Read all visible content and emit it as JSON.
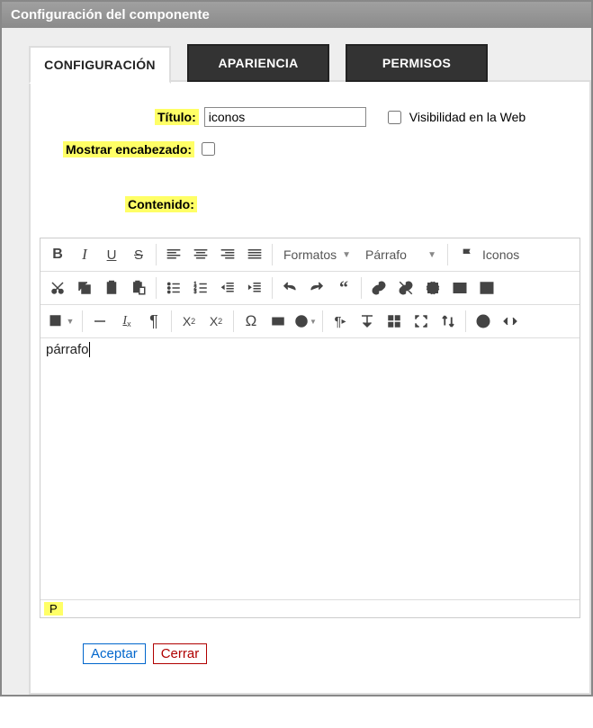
{
  "dialog": {
    "title": "Configuración del componente"
  },
  "tabs": {
    "config": "CONFIGURACIÓN",
    "appearance": "APARIENCIA",
    "perms": "PERMISOS"
  },
  "form": {
    "titulo_label": "Título:",
    "titulo_value": "iconos",
    "vis_web_label": "Visibilidad en la Web",
    "vis_web_checked": false,
    "show_header_label": "Mostrar encabezado:",
    "show_header_checked": false,
    "contenido_label": "Contenido:"
  },
  "editor": {
    "formats_label": "Formatos",
    "paragraph_label": "Párrafo",
    "icons_btn_label": "Iconos",
    "body_text": "párrafo",
    "status_path": "P"
  },
  "buttons": {
    "ok": "Aceptar",
    "close": "Cerrar"
  }
}
